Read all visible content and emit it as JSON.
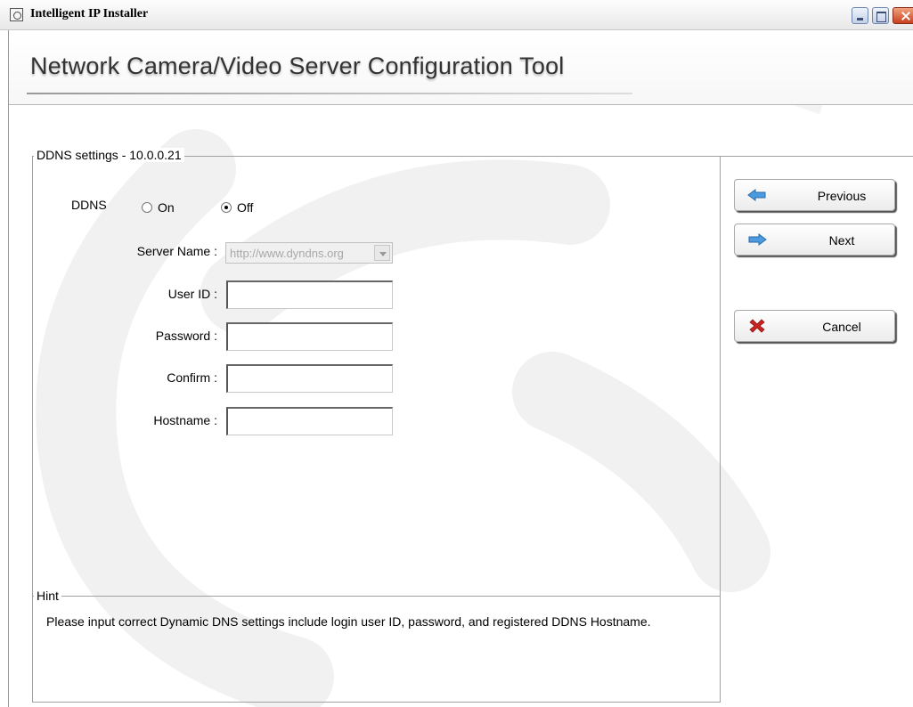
{
  "window": {
    "title": "Intelligent IP Installer"
  },
  "header": {
    "title": "Network Camera/Video Server Configuration Tool"
  },
  "ddns_group": {
    "label": "DDNS settings - 10.0.0.21",
    "ddns_label": "DDNS",
    "on_label": "On",
    "off_label": "Off",
    "selected": "Off",
    "fields": {
      "server_name_label": "Server Name :",
      "server_name_value": "http://www.dyndns.org",
      "user_id_label": "User ID :",
      "user_id_value": "",
      "password_label": "Password :",
      "password_value": "",
      "confirm_label": "Confirm :",
      "confirm_value": "",
      "hostname_label": "Hostname :",
      "hostname_value": ""
    }
  },
  "hint": {
    "label": "Hint",
    "text": "Please input correct Dynamic DNS settings include login user ID, password, and registered DDNS Hostname."
  },
  "buttons": {
    "previous": "Previous",
    "next": "Next",
    "cancel": "Cancel"
  },
  "icons": {
    "previous": "arrow-left-icon",
    "next": "arrow-right-icon",
    "cancel": "x-icon"
  },
  "colors": {
    "arrow_blue": "#4a9be0",
    "cancel_red": "#cc2222"
  }
}
